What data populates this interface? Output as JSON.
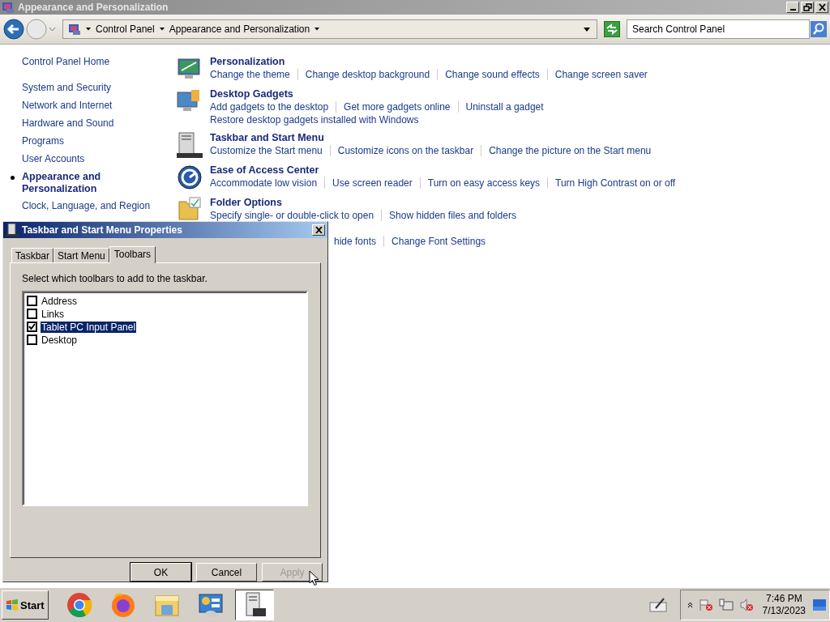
{
  "window": {
    "title": "Appearance and Personalization"
  },
  "address_bar": {
    "breadcrumb": [
      "Control Panel",
      "Appearance and Personalization"
    ],
    "search": {
      "placeholder": "Search Control Panel"
    }
  },
  "sidebar": {
    "home": "Control Panel Home",
    "items": [
      {
        "label": "System and Security",
        "selected": false
      },
      {
        "label": "Network and Internet",
        "selected": false
      },
      {
        "label": "Hardware and Sound",
        "selected": false
      },
      {
        "label": "Programs",
        "selected": false
      },
      {
        "label": "User Accounts",
        "selected": false
      },
      {
        "label": "Appearance and Personalization",
        "selected": true
      },
      {
        "label": "Clock, Language, and Region",
        "selected": false
      }
    ]
  },
  "categories": [
    {
      "kind": "personalization",
      "title": "Personalization",
      "lines": [
        [
          "Change the theme",
          "Change desktop background",
          "Change sound effects",
          "Change screen saver"
        ]
      ]
    },
    {
      "kind": "gadgets",
      "title": "Desktop Gadgets",
      "lines": [
        [
          "Add gadgets to the desktop",
          "Get more gadgets online",
          "Uninstall a gadget"
        ],
        [
          "Restore desktop gadgets installed with Windows"
        ]
      ]
    },
    {
      "kind": "taskbar",
      "title": "Taskbar and Start Menu",
      "lines": [
        [
          "Customize the Start menu",
          "Customize icons on the taskbar",
          "Change the picture on the Start menu"
        ]
      ]
    },
    {
      "kind": "access",
      "title": "Ease of Access Center",
      "lines": [
        [
          "Accommodate low vision",
          "Use screen reader",
          "Turn on easy access keys",
          "Turn High Contrast on or off"
        ]
      ]
    },
    {
      "kind": "folder",
      "title": "Folder Options",
      "lines": [
        [
          "Specify single- or double-click to open",
          "Show hidden files and folders"
        ]
      ]
    },
    {
      "kind": "covered",
      "lines": [
        [
          "hide fonts",
          "Change Font Settings"
        ]
      ]
    }
  ],
  "dialog": {
    "title": "Taskbar and Start Menu Properties",
    "tabs": [
      {
        "label": "Taskbar",
        "selected": false
      },
      {
        "label": "Start Menu",
        "selected": false
      },
      {
        "label": "Toolbars",
        "selected": true
      }
    ],
    "instruction": "Select which toolbars to add to the taskbar.",
    "toolbars": [
      {
        "label": "Address",
        "checked": false,
        "selected": false
      },
      {
        "label": "Links",
        "checked": false,
        "selected": false
      },
      {
        "label": "Tablet PC Input Panel",
        "checked": true,
        "selected": true
      },
      {
        "label": "Desktop",
        "checked": false,
        "selected": false
      }
    ],
    "buttons": [
      {
        "label": "OK",
        "default": true,
        "disabled": false
      },
      {
        "label": "Cancel",
        "default": false,
        "disabled": false
      },
      {
        "label": "Apply",
        "default": false,
        "disabled": true
      }
    ]
  },
  "taskbar": {
    "start": "Start",
    "apps": [
      {
        "kind": "chrome",
        "active": false
      },
      {
        "kind": "firefox",
        "active": false
      },
      {
        "kind": "explorer",
        "active": false
      },
      {
        "kind": "control-panel",
        "active": false
      },
      {
        "kind": "taskbar-properties",
        "active": true
      }
    ],
    "tray": {
      "time": "7:46 PM",
      "date": "7/13/2023"
    }
  }
}
